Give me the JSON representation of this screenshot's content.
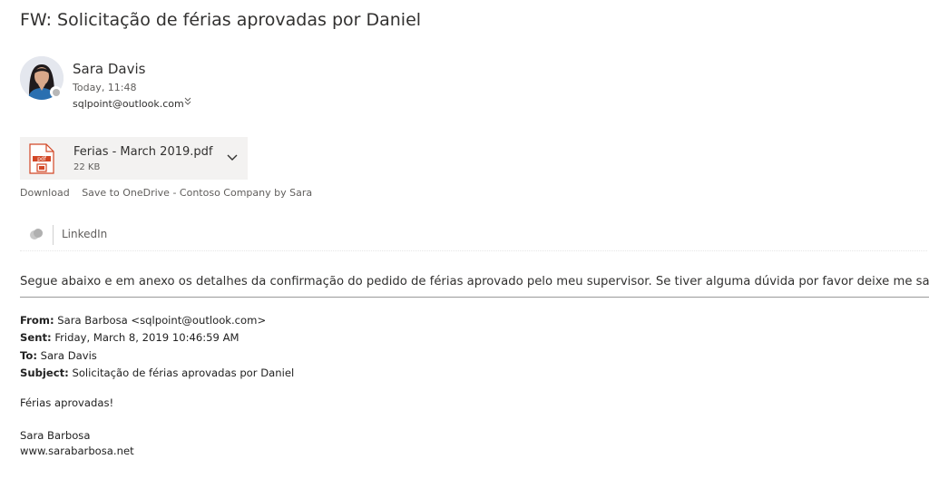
{
  "email": {
    "subject": "FW: Solicitação de férias aprovadas por Daniel",
    "sender": {
      "name": "Sara Davis",
      "time": "Today, 11:48",
      "to": "sqlpoint@outlook.com",
      "presence_color": "#b7b7b7"
    },
    "attachment": {
      "name": "Ferias - March 2019.pdf",
      "size": "22 KB",
      "icon": "pdf-file-icon",
      "icon_label": "pdf",
      "actions": [
        "Download",
        "Save to OneDrive - Contoso Company by Sara"
      ]
    },
    "addins": {
      "icon": "linkedin-logo-icon",
      "label": "LinkedIn"
    },
    "intro": "Segue abaixo e em anexo os detalhes da confirmação do pedido de férias aprovado pelo meu supervisor. Se tiver alguma dúvida por favor deixe me saber.",
    "forwarded": {
      "from_label": "From:",
      "from_value": "Sara Barbosa <sqlpoint@outlook.com>",
      "sent_label": "Sent:",
      "sent_value": "Friday, March 8, 2019 10:46:59 AM",
      "to_label": "To:",
      "to_value": "Sara Davis",
      "subject_label": "Subject:",
      "subject_value": "Solicitação de férias aprovadas por Daniel",
      "body": "Férias aprovadas!",
      "signature_name": "Sara Barbosa",
      "signature_site": "www.sarabarbosa.net"
    }
  },
  "colors": {
    "pdf_accent": "#d24726",
    "attachment_bg": "#f3f2f1"
  }
}
